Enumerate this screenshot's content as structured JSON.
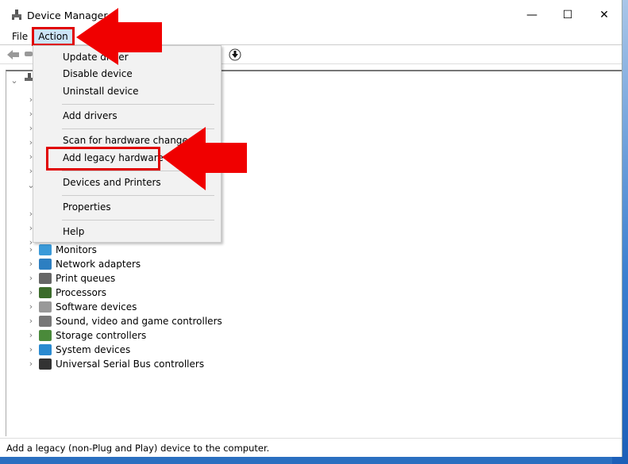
{
  "window": {
    "title": "Device Manager",
    "minimize": "—",
    "maximize": "☐",
    "close": "✕"
  },
  "menubar": {
    "file": "File",
    "action": "Action"
  },
  "action_menu": {
    "items": [
      "Update driver",
      "Disable device",
      "Uninstall device",
      "Add drivers",
      "Scan for hardware changes",
      "Add legacy hardware",
      "Devices and Printers",
      "Properties",
      "Help"
    ],
    "highlighted": "Add legacy hardware"
  },
  "tree": {
    "visible_items": [
      {
        "label": "Monitors",
        "icon": "monitor-icon"
      },
      {
        "label": "Network adapters",
        "icon": "network-icon"
      },
      {
        "label": "Print queues",
        "icon": "printer-icon"
      },
      {
        "label": "Processors",
        "icon": "processor-icon"
      },
      {
        "label": "Software devices",
        "icon": "software-device-icon"
      },
      {
        "label": "Sound, video and game controllers",
        "icon": "speaker-icon"
      },
      {
        "label": "Storage controllers",
        "icon": "storage-icon"
      },
      {
        "label": "System devices",
        "icon": "system-icon"
      },
      {
        "label": "Universal Serial Bus controllers",
        "icon": "usb-icon"
      }
    ]
  },
  "status": "Add a legacy (non-Plug and Play) device to the computer.",
  "colors": {
    "annotation": "#e00000",
    "menu_highlight": "#cce4f7"
  }
}
